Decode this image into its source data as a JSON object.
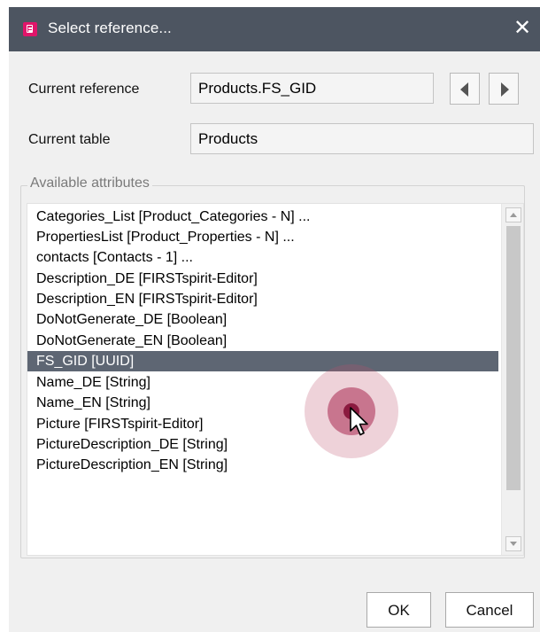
{
  "window": {
    "title": "Select reference..."
  },
  "current_reference": {
    "label": "Current reference",
    "value": "Products.FS_GID"
  },
  "current_table": {
    "label": "Current table",
    "value": "Products"
  },
  "attributes": {
    "group_label": "Available attributes",
    "items": [
      "Categories_List [Product_Categories - N]  ...",
      "PropertiesList [Product_Properties - N]  ...",
      "contacts [Contacts - 1]  ...",
      "Description_DE [FIRSTspirit-Editor]",
      "Description_EN [FIRSTspirit-Editor]",
      "DoNotGenerate_DE [Boolean]",
      "DoNotGenerate_EN [Boolean]",
      "FS_GID [UUID]",
      "Name_DE [String]",
      "Name_EN [String]",
      "Picture [FIRSTspirit-Editor]",
      "PictureDescription_DE [String]",
      "PictureDescription_EN [String]"
    ],
    "selected_item": "FS_GID [UUID]"
  },
  "buttons": {
    "ok": "OK",
    "cancel": "Cancel"
  },
  "colors": {
    "titlebar": "#4d5561",
    "selection": "#5e6673",
    "app_icon": "#e0156a",
    "click_indicator": "#8b1a3f"
  },
  "icons": {
    "app": "document-icon",
    "close": "close-icon",
    "previous": "triangle-left-icon",
    "next": "triangle-right-icon",
    "cursor": "arrow-cursor-icon"
  }
}
